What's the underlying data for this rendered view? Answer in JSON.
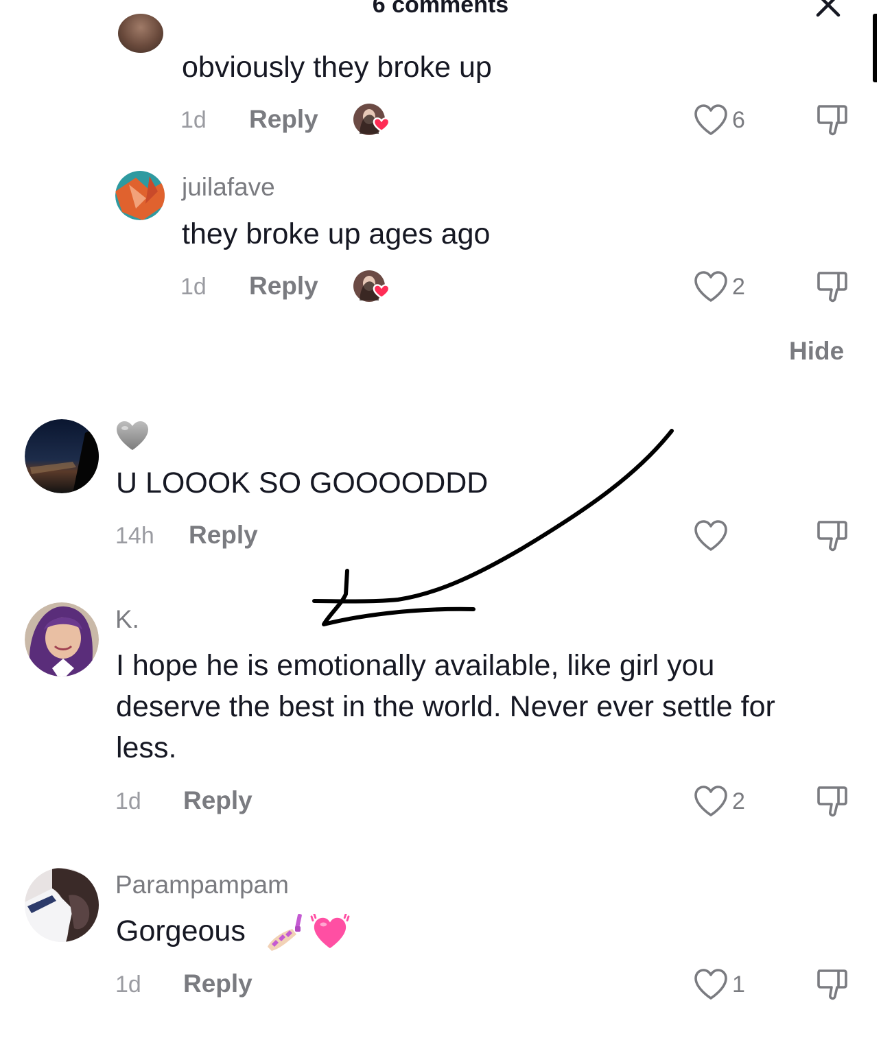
{
  "header": {
    "title": "6 comments",
    "close_icon": "close-icon"
  },
  "comments": [
    {
      "username": "",
      "text": "obviously they broke up",
      "time": "1d",
      "reply_label": "Reply",
      "likes": "6",
      "liked_by_creator": true
    },
    {
      "username": "juilafave",
      "text": "they broke up ages ago",
      "time": "1d",
      "reply_label": "Reply",
      "likes": "2",
      "liked_by_creator": true
    },
    {
      "username": "",
      "text": "U LOOOK SO GOOOODDD",
      "time": "14h",
      "reply_label": "Reply",
      "likes": "",
      "liked_by_creator": false
    },
    {
      "username": "K.",
      "text_lines": [
        "I hope he is emotionally available, like girl you",
        "deserve the best in the world. Never ever settle for",
        "less."
      ],
      "time": "1d",
      "reply_label": "Reply",
      "likes": "2",
      "liked_by_creator": false
    },
    {
      "username": "Parampampam",
      "text": "Gorgeous",
      "time": "1d",
      "reply_label": "Reply",
      "likes": "1",
      "liked_by_creator": false
    }
  ],
  "thread": {
    "hide_label": "Hide"
  },
  "colors": {
    "text": "#161823",
    "muted": "#7a7b80",
    "heart": "#fe2c55"
  }
}
